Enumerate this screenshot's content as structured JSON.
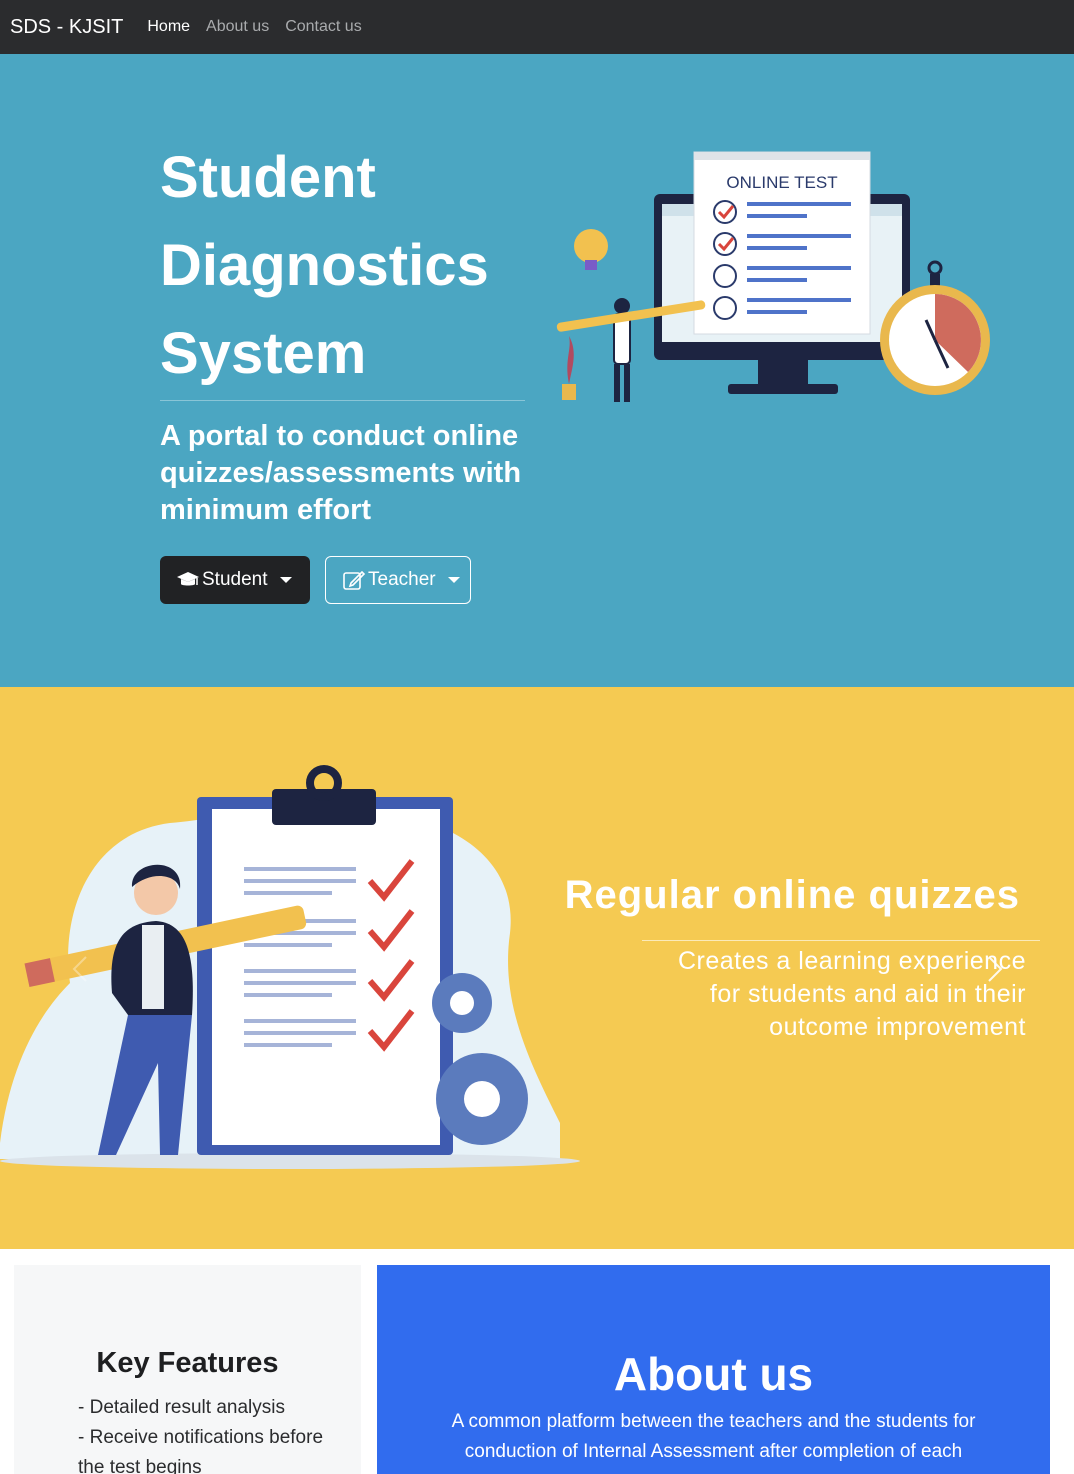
{
  "navbar": {
    "brand": "SDS - KJSIT",
    "links": [
      {
        "label": "Home",
        "active": true
      },
      {
        "label": "About us",
        "active": false
      },
      {
        "label": "Contact us",
        "active": false
      }
    ]
  },
  "hero": {
    "title_lines": [
      "Student",
      "Diagnostics",
      "System"
    ],
    "subtitle": "A portal to conduct online quizzes/assessments with minimum effort",
    "buttons": {
      "student": {
        "label": "Student",
        "icon": "graduation-cap-icon"
      },
      "teacher": {
        "label": "Teacher",
        "icon": "edit-icon"
      }
    },
    "illustration": {
      "screen_text": "ONLINE TEST"
    },
    "background_color": "#4ba6c2"
  },
  "carousel": {
    "slide_title": "Regular online quizzes",
    "slide_text": "Creates a learning experience for students and aid in their outcome improvement",
    "background_color": "#f5ca52"
  },
  "features": {
    "title": "Key Features",
    "items": [
      "- Detailed result analysis",
      "- Receive notifications before the test begins"
    ]
  },
  "about": {
    "title": "About us",
    "text": "A common platform between the teachers and the students for conduction of Internal Assessment after completion of each",
    "background_color": "#316cee"
  }
}
